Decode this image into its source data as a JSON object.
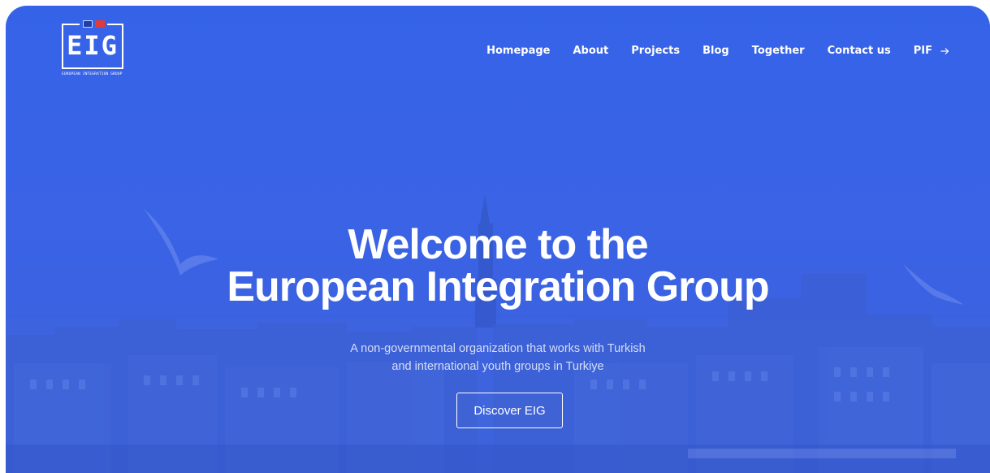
{
  "brand": {
    "logo_text": "EIG",
    "logo_subtitle": "EUROPEAN INTEGRATION GROUP",
    "colors": {
      "primary": "#3563e8",
      "text": "#ffffff"
    }
  },
  "nav": {
    "items": [
      {
        "label": "Homepage"
      },
      {
        "label": "About"
      },
      {
        "label": "Projects"
      },
      {
        "label": "Blog"
      },
      {
        "label": "Together"
      },
      {
        "label": "Contact us"
      },
      {
        "label": "PIF",
        "icon": "arrow-right-icon"
      }
    ]
  },
  "hero": {
    "title_line1": "Welcome to the",
    "title_line2": "European Integration Group",
    "subtitle_line1": "A non-governmental organization that works with Turkish",
    "subtitle_line2": "and international youth groups in Turkiye",
    "cta_label": "Discover EIG"
  }
}
